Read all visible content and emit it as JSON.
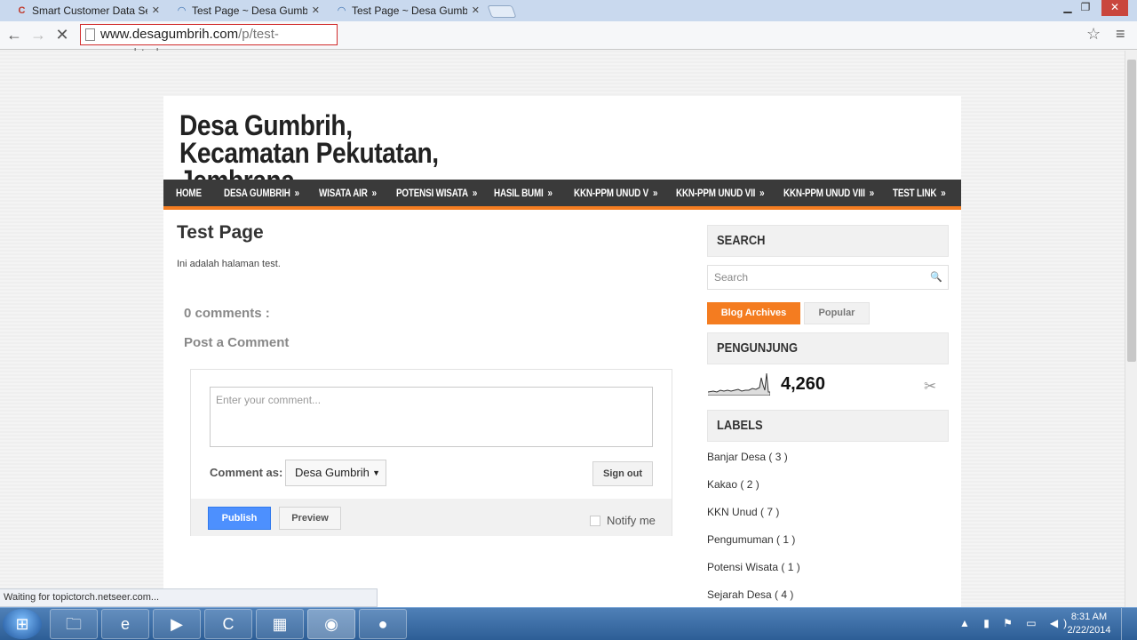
{
  "browser": {
    "tabs": [
      {
        "title": "Smart Customer Data Serv",
        "icon": "site-c-icon"
      },
      {
        "title": "Test Page ~ Desa Gumbrih",
        "icon": "loading-icon"
      },
      {
        "title": "Test Page ~ Desa Gumbrih",
        "icon": "loading-icon"
      }
    ],
    "close_glyph": "✕",
    "url_host": "www.desagumbrih.com",
    "url_path": "/p/test-page.html",
    "status": "Waiting for topictorch.netseer.com..."
  },
  "blog": {
    "title": "Desa Gumbrih, Kecamatan Pekutatan, Jembrana",
    "nav": [
      {
        "label": "HOME",
        "arrow": ""
      },
      {
        "label": "DESA GUMBRIH",
        "arrow": "»"
      },
      {
        "label": "WISATA AIR",
        "arrow": "»"
      },
      {
        "label": "POTENSI WISATA",
        "arrow": "»"
      },
      {
        "label": "HASIL BUMI",
        "arrow": "»"
      },
      {
        "label": "KKN-PPM UNUD V",
        "arrow": "»"
      },
      {
        "label": "KKN-PPM UNUD VII",
        "arrow": "»"
      },
      {
        "label": "KKN-PPM UNUD VIII",
        "arrow": "»"
      },
      {
        "label": "TEST LINK",
        "arrow": "»"
      }
    ]
  },
  "post": {
    "title": "Test Page",
    "body": "Ini adalah halaman test.",
    "comments_count": "0 comments :",
    "post_comment": "Post a Comment"
  },
  "comment_form": {
    "placeholder": "Enter your comment...",
    "comment_as_label": "Comment as:",
    "identity": "Desa Gumbrih",
    "sign_out": "Sign out",
    "publish": "Publish",
    "preview": "Preview",
    "notify": "Notify me"
  },
  "sidebar": {
    "search_heading": "SEARCH",
    "search_placeholder": "Search",
    "tabs": [
      "Blog Archives",
      "Popular"
    ],
    "visitors_heading": "PENGUNJUNG",
    "visitor_count": "4,260",
    "labels_heading": "LABELS",
    "labels": [
      "Banjar Desa ( 3 )",
      "Kakao ( 2 )",
      "KKN Unud ( 7 )",
      "Pengumuman ( 1 )",
      "Potensi Wisata ( 1 )",
      "Sejarah Desa ( 4 )"
    ]
  },
  "taskbar": {
    "clock_time": "8:31 AM",
    "clock_date": "2/22/2014",
    "apps": [
      "explorer-icon",
      "internet-explorer-icon",
      "media-player-icon",
      "app-c-icon",
      "control-panel-icon",
      "chrome-icon",
      "obs-icon"
    ]
  },
  "colors": {
    "accent": "#f47c20",
    "nav_bg": "#3a3a3a",
    "publish": "#4d90fe"
  }
}
